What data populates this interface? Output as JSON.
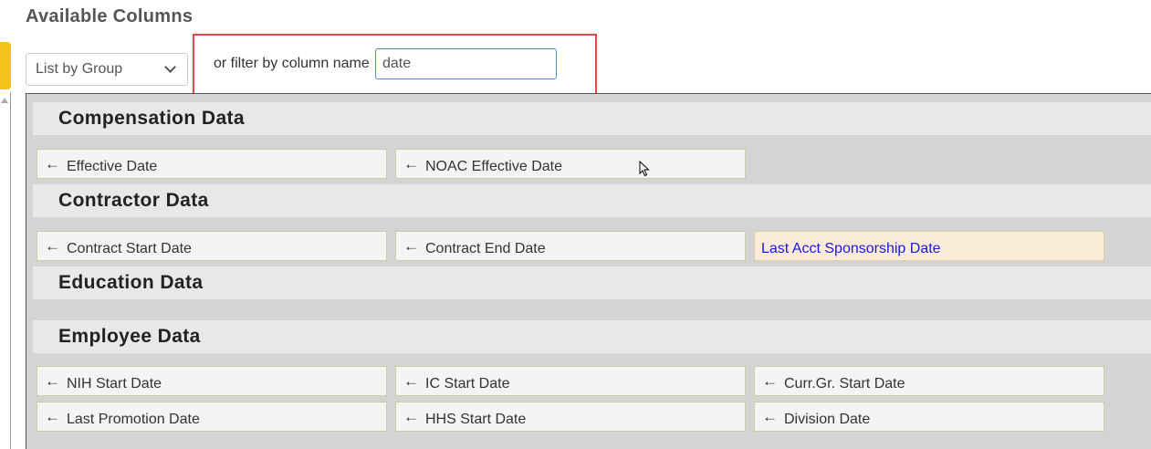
{
  "page": {
    "title": "Available Columns"
  },
  "group_select": {
    "value": "List by Group"
  },
  "filter": {
    "label": "or filter by column name",
    "value": "date"
  },
  "groups": [
    {
      "title": "Compensation Data",
      "items": [
        {
          "label": "Effective Date",
          "arrow": true
        },
        {
          "label": "NOAC Effective Date",
          "arrow": true
        }
      ]
    },
    {
      "title": "Contractor Data",
      "items": [
        {
          "label": "Contract Start Date",
          "arrow": true
        },
        {
          "label": "Contract End Date",
          "arrow": true
        },
        {
          "label": "Last Acct Sponsorship Date",
          "arrow": false,
          "highlight": true
        }
      ]
    },
    {
      "title": "Education Data",
      "items": []
    },
    {
      "title": "Employee Data",
      "items": [
        {
          "label": "NIH Start Date",
          "arrow": true
        },
        {
          "label": "IC Start Date",
          "arrow": true
        },
        {
          "label": "Curr.Gr. Start Date",
          "arrow": true
        },
        {
          "label": "Last Promotion Date",
          "arrow": true
        },
        {
          "label": "HHS Start Date",
          "arrow": true
        },
        {
          "label": "Division Date",
          "arrow": true
        }
      ]
    }
  ],
  "icons": {
    "arrow": "arrow-left-icon",
    "chevron": "chevron-down-icon"
  }
}
